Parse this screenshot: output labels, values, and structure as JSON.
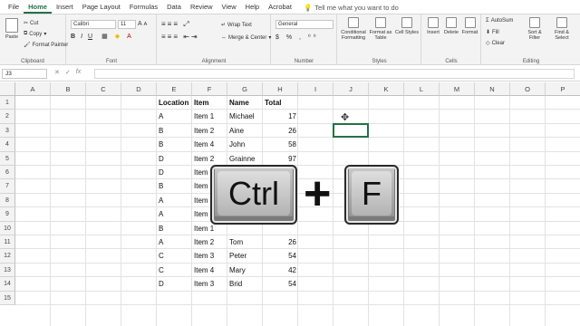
{
  "tabs": [
    "File",
    "Home",
    "Insert",
    "Page Layout",
    "Formulas",
    "Data",
    "Review",
    "View",
    "Help",
    "Acrobat"
  ],
  "tell_me": "Tell me what you want to do",
  "clipboard": {
    "cut": "Cut",
    "copy": "Copy",
    "paste": "Paste",
    "format_painter": "Format Painter",
    "label": "Clipboard"
  },
  "font": {
    "name": "Calibri",
    "size": "11",
    "bold": "B",
    "italic": "I",
    "underline": "U",
    "grow": "A",
    "shrink": "A",
    "label": "Font"
  },
  "alignment": {
    "wrap": "Wrap Text",
    "merge": "Merge & Center",
    "label": "Alignment"
  },
  "number": {
    "format": "General",
    "label": "Number"
  },
  "styles": {
    "conditional": "Conditional Formatting",
    "format_table": "Format as Table",
    "cell_styles": "Cell Styles",
    "label": "Styles"
  },
  "cells": {
    "insert": "Insert",
    "delete": "Delete",
    "format": "Format",
    "label": "Cells"
  },
  "editing": {
    "autosum": "AutoSum",
    "fill": "Fill",
    "clear": "Clear",
    "sort": "Sort & Filter",
    "find": "Find & Select",
    "label": "Editing"
  },
  "formula_bar": {
    "name_box": "J3",
    "x": "✕",
    "check": "✓",
    "fx": "fx"
  },
  "columns": [
    "A",
    "B",
    "C",
    "D",
    "E",
    "F",
    "G",
    "H",
    "I",
    "J",
    "K",
    "L",
    "M",
    "N",
    "O",
    "P"
  ],
  "rows": [
    "1",
    "2",
    "3",
    "4",
    "5",
    "6",
    "7",
    "8",
    "9",
    "10",
    "11",
    "12",
    "13",
    "14",
    "15"
  ],
  "headers": {
    "location": "Location",
    "item": "Item",
    "name": "Name",
    "total": "Total"
  },
  "data": [
    {
      "loc": "A",
      "item": "Item 1",
      "name": "Michael",
      "total": "17"
    },
    {
      "loc": "B",
      "item": "Item 2",
      "name": "Aine",
      "total": "26"
    },
    {
      "loc": "B",
      "item": "Item 4",
      "name": "John",
      "total": "58"
    },
    {
      "loc": "D",
      "item": "Item 2",
      "name": "Grainne",
      "total": "97"
    },
    {
      "loc": "D",
      "item": "Item 1",
      "name": "",
      "total": ""
    },
    {
      "loc": "B",
      "item": "Item 4",
      "name": "",
      "total": ""
    },
    {
      "loc": "A",
      "item": "Item 2",
      "name": "",
      "total": ""
    },
    {
      "loc": "A",
      "item": "Item 2",
      "name": "",
      "total": ""
    },
    {
      "loc": "B",
      "item": "Item 1",
      "name": "",
      "total": ""
    },
    {
      "loc": "A",
      "item": "Item 2",
      "name": "Tom",
      "total": "26"
    },
    {
      "loc": "C",
      "item": "Item 3",
      "name": "Peter",
      "total": "54"
    },
    {
      "loc": "C",
      "item": "Item 4",
      "name": "Mary",
      "total": "42"
    },
    {
      "loc": "D",
      "item": "Item 3",
      "name": "Brid",
      "total": "54"
    }
  ],
  "keys": {
    "ctrl": "Ctrl",
    "plus": "+",
    "f": "F"
  },
  "accent": "#217346"
}
